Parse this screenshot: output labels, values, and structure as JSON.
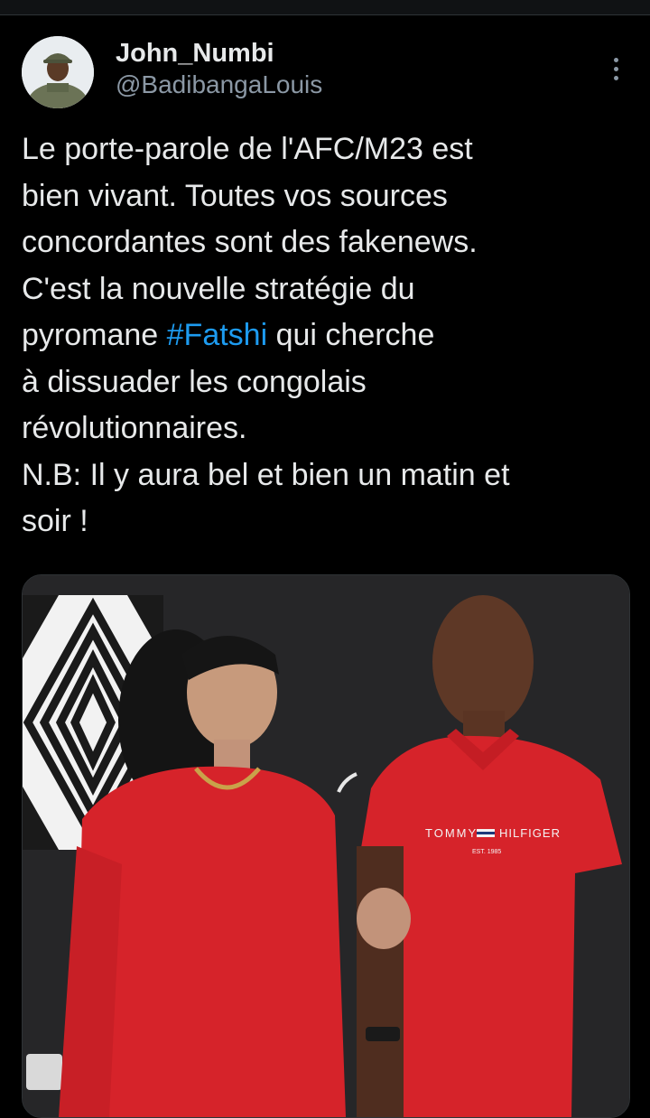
{
  "author": {
    "display_name": "John_Numbi",
    "handle": "@BadibangaLouis"
  },
  "tweet": {
    "lines": [
      [
        "Le porte-parole de l'AFC/M23 est"
      ],
      [
        "bien vivant. Toutes vos sources"
      ],
      [
        "concordantes sont des fakenews."
      ],
      [
        "C'est la nouvelle stratégie du"
      ],
      [
        "pyromane ",
        "#Fatshi",
        " qui cherche"
      ],
      [
        "à dissuader les congolais"
      ],
      [
        "révolutionnaires."
      ],
      [
        "N.B: Il y aura bel et bien un matin et"
      ],
      [
        "soir !"
      ]
    ],
    "hashtag": "#Fatshi"
  },
  "media": {
    "shirt_brand": "TOMMY",
    "shirt_brand_2": "HILFIGER",
    "shirt_est": "EST. 1985"
  },
  "colors": {
    "background": "#000000",
    "text": "#e7e9ea",
    "secondary_text": "#8b98a5",
    "link": "#1d9bf0",
    "shirt_red": "#d6232a"
  },
  "icons": {
    "more": "more-vertical-icon"
  }
}
